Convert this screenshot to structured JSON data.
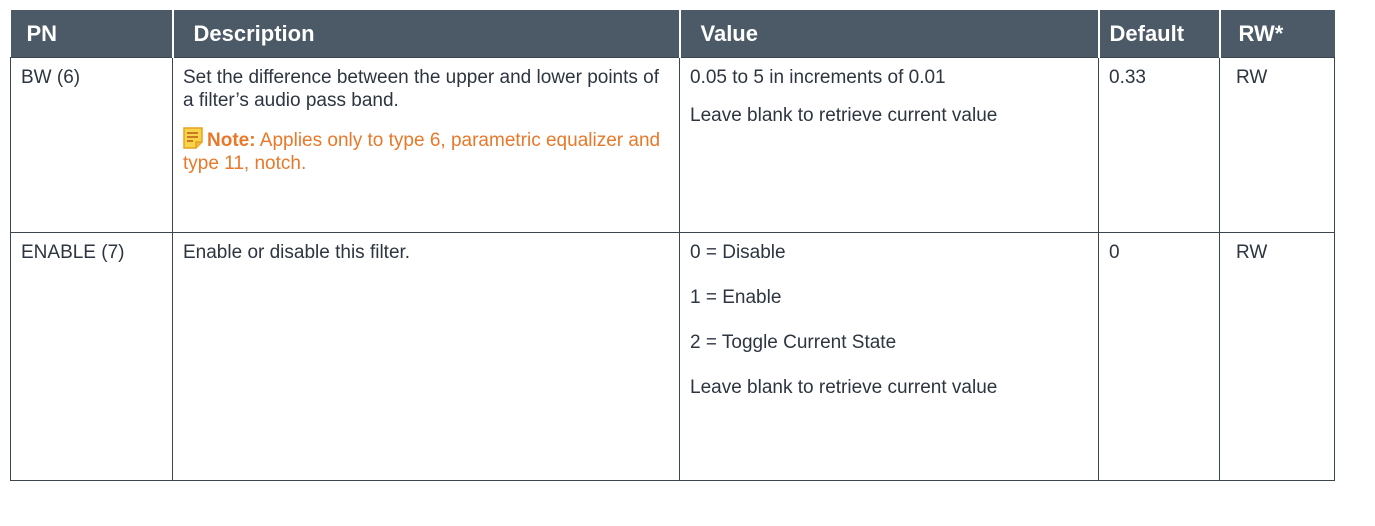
{
  "table": {
    "headers": {
      "pn": "PN",
      "description": "Description",
      "value": "Value",
      "default": "Default",
      "rw": "RW*"
    },
    "rows": [
      {
        "pn": "BW (6)",
        "description": "Set the difference between the upper and lower points of a filter’s audio pass band.",
        "note_label": "Note:",
        "note_text": "Applies only to type 6, parametric equalizer and type 11, notch.",
        "value_lines": [
          "0.05 to 5 in increments of 0.01",
          "Leave blank to retrieve current value"
        ],
        "default": "0.33",
        "rw": "RW"
      },
      {
        "pn": "ENABLE (7)",
        "description": "Enable or disable this filter.",
        "value_lines": [
          "0 = Disable",
          "1 = Enable",
          "2 = Toggle Current State",
          "Leave blank to retrieve current value"
        ],
        "default": "0",
        "rw": "RW"
      }
    ]
  },
  "colors": {
    "header_bg": "#4b5a66",
    "header_text": "#ffffff",
    "note": "#e8782a",
    "body_text": "#2d3540"
  },
  "icons": {
    "note": "note-icon"
  }
}
